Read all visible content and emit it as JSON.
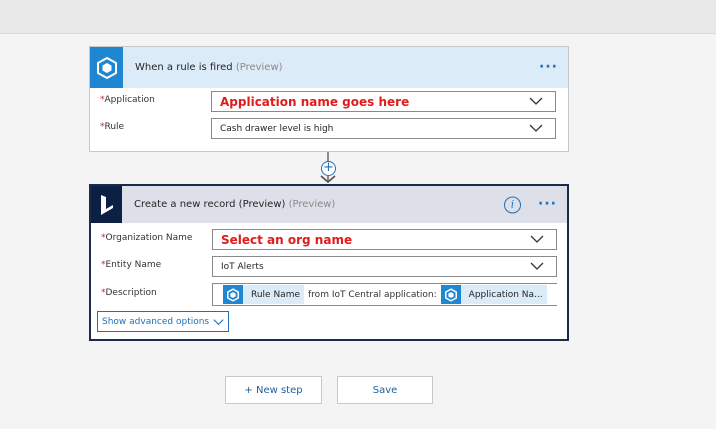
{
  "trigger": {
    "title": "When a rule is fired",
    "preview": "(Preview)",
    "fields": [
      {
        "label": "Application",
        "value": "Application name goes here"
      },
      {
        "label": "Rule",
        "value": "Cash drawer level is high"
      }
    ]
  },
  "action": {
    "title": "Create a new record (Preview)",
    "preview": "(Preview)",
    "fields": {
      "org": {
        "label": "Organization Name",
        "value": "Select an org name"
      },
      "entity": {
        "label": "Entity Name",
        "value": "IoT Alerts"
      },
      "description": {
        "label": "Description",
        "token1": "Rule Name",
        "text": "from IoT Central application:",
        "token2": "Application Na..."
      }
    },
    "advanced": "Show advanced options"
  },
  "required_mark": "*",
  "buttons": {
    "new_step": "+ New step",
    "save": "Save"
  },
  "icons": {
    "more": "more-options-icon",
    "info": "info-icon",
    "chevron": "chevron-down-icon",
    "iot": "iot-central-icon",
    "dynamics": "dynamics-icon",
    "add": "add-step-icon",
    "arrow": "arrow-down-icon"
  },
  "colors": {
    "accent": "#1f86d1",
    "dynamics_dark": "#0c1f44",
    "error_red": "#e21b1b",
    "required": "#c4262e"
  }
}
